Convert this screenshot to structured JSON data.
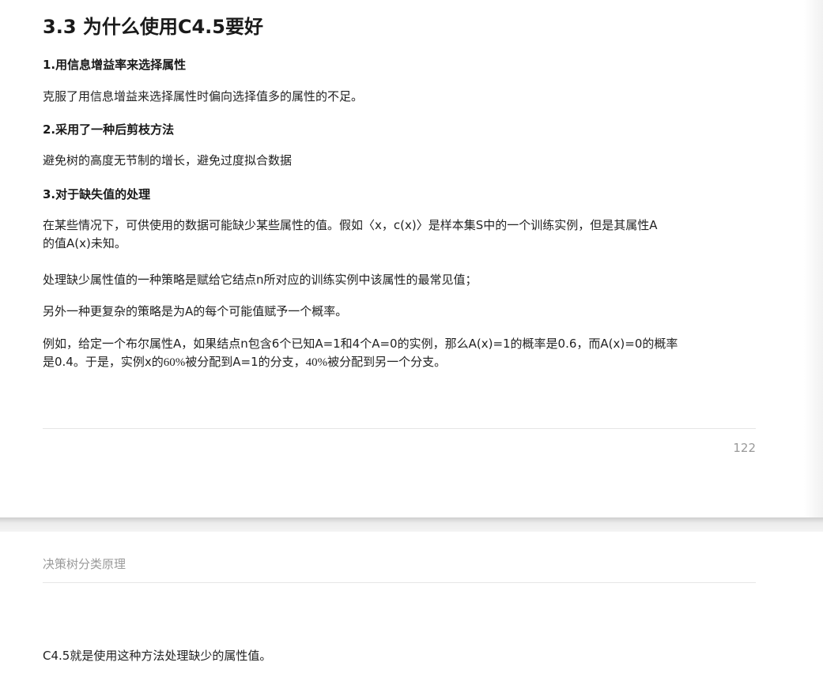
{
  "page1": {
    "title": "3.3 为什么使用C4.5要好",
    "sections": [
      {
        "heading": "1.用信息增益率来选择属性"
      },
      {
        "heading": "2.采用了一种后剪枝方法"
      },
      {
        "heading": "3.对于缺失值的处理"
      }
    ],
    "paras": {
      "p1": "克服了用信息增益来选择属性时偏向选择值多的属性的不足。",
      "p2": "避免树的高度无节制的增长，避免过度拟合数据",
      "p3_line1": "在某些情况下，可供使用的数据可能缺少某些属性的值。假如〈x，c(x)〉是样本集S中的一个训练实例，但是其属性A",
      "p3_line2": "的值A(x)未知。",
      "p4": "处理缺少属性值的一种策略是赋给它结点n所对应的训练实例中该属性的最常见值；",
      "p5": "另外一种更复杂的策略是为A的每个可能值赋予一个概率。",
      "p6_line1": "例如，给定一个布尔属性A，如果结点n包含6个已知A=1和4个A=0的实例，那么A(x)=1的概率是0.6，而A(x)=0的概率",
      "p6_line2_a": "是0.4。于是，实例x的",
      "p6_line2_b": "60%",
      "p6_line2_c": "被分配到A=1的分支，",
      "p6_line2_d": "40%",
      "p6_line2_e": "被分配到另一个分支。"
    },
    "page_number": "122"
  },
  "page2": {
    "header": "决策树分类原理",
    "text": "C4.5就是使用这种方法处理缺少的属性值。"
  }
}
